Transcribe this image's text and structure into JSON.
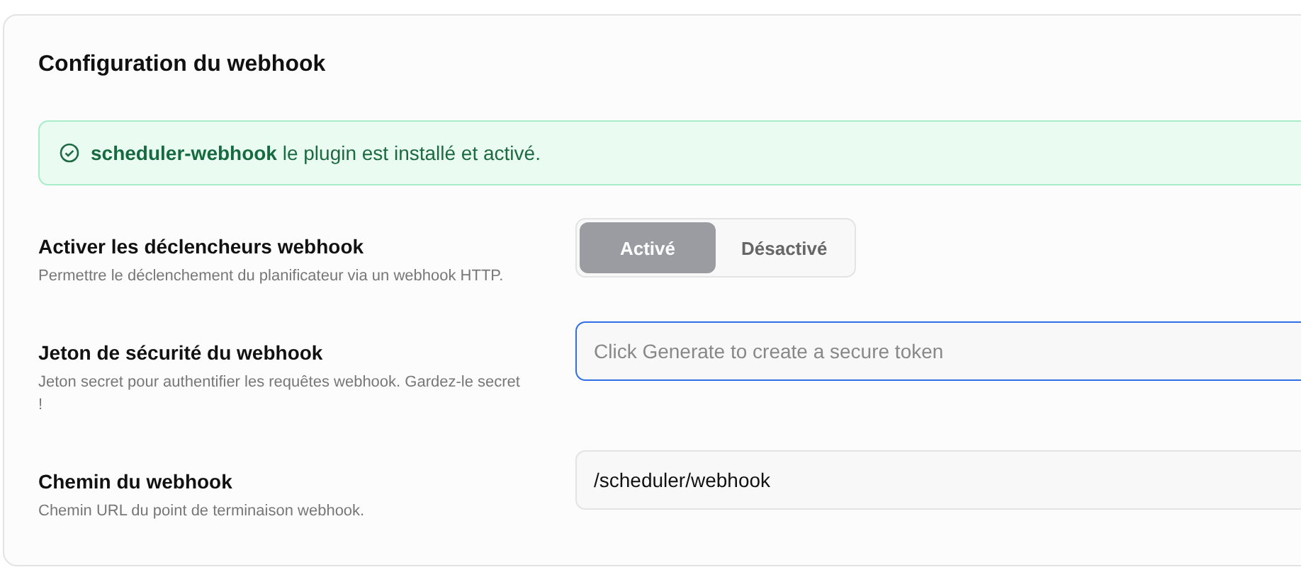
{
  "card": {
    "title": "Configuration du webhook"
  },
  "notice": {
    "text": "**scheduler-webhook** le plugin est installé et activé."
  },
  "settings": [
    {
      "kind": "toggle",
      "label": "Activer les déclencheurs webhook",
      "description": "Permettre le déclenchement du planificateur via un webhook HTTP.",
      "options": [
        {
          "label": "Activé",
          "selected": true
        },
        {
          "label": "Désactivé",
          "selected": false
        }
      ]
    },
    {
      "kind": "input",
      "label": "Jeton de sécurité du webhook",
      "description": "Jeton secret pour authentifier les requêtes webhook. Gardez-le secret !",
      "placeholder": "Click Generate to create a secure token",
      "focused": true
    },
    {
      "kind": "input",
      "label": "Chemin du webhook",
      "description": "Chemin URL du point de terminaison webhook.",
      "value": "/scheduler/webhook",
      "focused": false
    }
  ]
}
